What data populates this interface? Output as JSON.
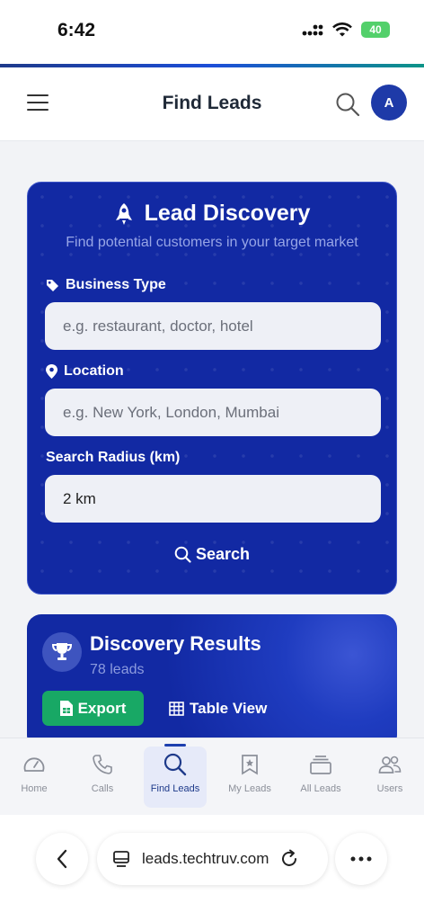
{
  "status": {
    "time": "6:42",
    "battery": "40"
  },
  "header": {
    "title": "Find Leads",
    "avatar_letter": "A"
  },
  "discovery": {
    "title": "Lead Discovery",
    "subtitle": "Find potential customers in your target market",
    "business_type_label": "Business Type",
    "business_type_placeholder": "e.g. restaurant, doctor, hotel",
    "location_label": "Location",
    "location_placeholder": "e.g. New York, London, Mumbai",
    "radius_label": "Search Radius (km)",
    "radius_value": "2 km",
    "search_label": "Search"
  },
  "results": {
    "title": "Discovery Results",
    "count": "78 leads",
    "export_label": "Export",
    "table_view_label": "Table View"
  },
  "nav": {
    "items": [
      {
        "label": "Home",
        "icon": "gauge-icon"
      },
      {
        "label": "Calls",
        "icon": "phone-icon"
      },
      {
        "label": "Find Leads",
        "icon": "search-icon",
        "active": true
      },
      {
        "label": "My Leads",
        "icon": "bookmark-icon"
      },
      {
        "label": "All Leads",
        "icon": "stack-icon"
      },
      {
        "label": "Users",
        "icon": "users-icon"
      }
    ]
  },
  "browser": {
    "url": "leads.techtruv.com"
  },
  "colors": {
    "primary": "#1229a3",
    "accent_green": "#18a865",
    "active_nav": "#1e3a8a"
  }
}
